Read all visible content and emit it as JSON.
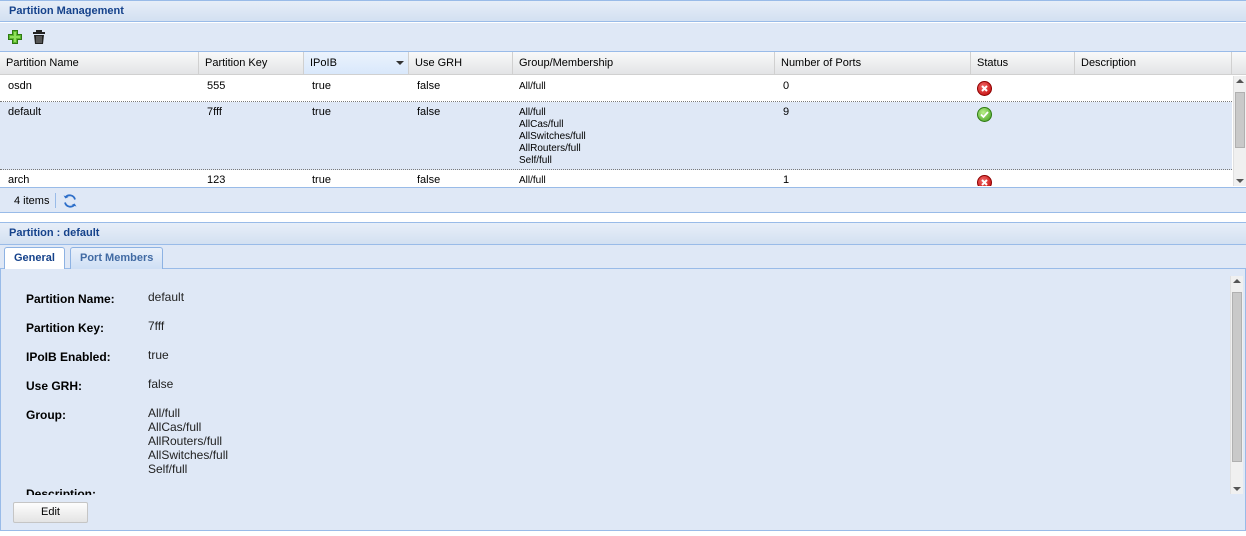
{
  "partition_panel": {
    "title": "Partition Management"
  },
  "toolbar": {
    "add_icon": "add-icon",
    "delete_icon": "trash-icon"
  },
  "grid": {
    "columns": [
      "Partition Name",
      "Partition Key",
      "IPoIB",
      "Use GRH",
      "Group/Membership",
      "Number of Ports",
      "Status",
      "Description"
    ],
    "rows": [
      {
        "name": "osdn",
        "key": "555",
        "ipoib": "true",
        "grh": "false",
        "groups": [
          "All/full"
        ],
        "ports": "0",
        "status": "error",
        "description": ""
      },
      {
        "name": "default",
        "key": "7fff",
        "ipoib": "true",
        "grh": "false",
        "groups": [
          "All/full",
          "AllCas/full",
          "AllSwitches/full",
          "AllRouters/full",
          "Self/full"
        ],
        "ports": "9",
        "status": "ok",
        "description": ""
      },
      {
        "name": "arch",
        "key": "123",
        "ipoib": "true",
        "grh": "false",
        "groups": [
          "All/full"
        ],
        "ports": "1",
        "status": "error",
        "description": ""
      }
    ],
    "selected_row": 1
  },
  "paging": {
    "count_text": "4 items",
    "refresh_icon": "refresh-icon"
  },
  "detail": {
    "title": "Partition : default",
    "tabs": [
      {
        "label": "General",
        "active": true
      },
      {
        "label": "Port Members",
        "active": false
      }
    ],
    "fields": {
      "name_label": "Partition Name:",
      "name_value": "default",
      "key_label": "Partition Key:",
      "key_value": "7fff",
      "ipoib_label": "IPoIB Enabled:",
      "ipoib_value": "true",
      "grh_label": "Use GRH:",
      "grh_value": "false",
      "group_label": "Group:",
      "group_values": [
        "All/full",
        "AllCas/full",
        "AllRouters/full",
        "AllSwitches/full",
        "Self/full"
      ],
      "description_label": "Description:"
    },
    "edit_label": "Edit"
  },
  "colors": {
    "header_text": "#15428b",
    "panel_bg": "#dfe8f6",
    "border": "#99bbe8",
    "status_error": "#c00000",
    "status_ok": "#3d9b1b"
  }
}
